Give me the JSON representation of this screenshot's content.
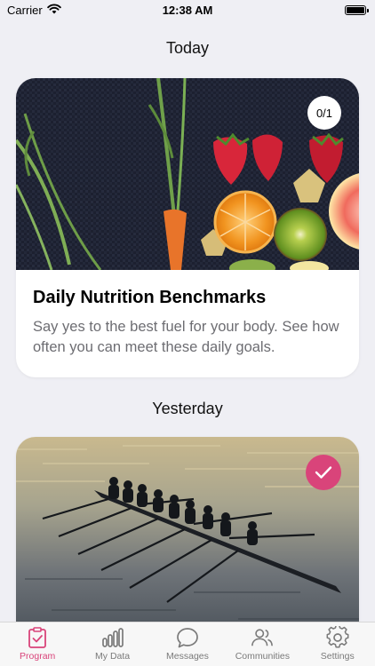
{
  "status_bar": {
    "carrier": "Carrier",
    "time": "12:38 AM"
  },
  "sections": {
    "today": "Today",
    "yesterday": "Yesterday"
  },
  "cards": [
    {
      "title": "Daily Nutrition Benchmarks",
      "description": "Say yes to the best fuel for your body. See how often you can meet these daily goals.",
      "progress_label": "0/1",
      "image_subject": "fruits-and-vegetables-photo"
    },
    {
      "image_subject": "rowing-crew-photo",
      "completed": true
    }
  ],
  "tabs": [
    {
      "label": "Program",
      "icon": "program-icon",
      "active": true
    },
    {
      "label": "My Data",
      "icon": "bar-chart-icon",
      "active": false
    },
    {
      "label": "Messages",
      "icon": "chat-bubble-icon",
      "active": false
    },
    {
      "label": "Communities",
      "icon": "people-icon",
      "active": false
    },
    {
      "label": "Settings",
      "icon": "gear-icon",
      "active": false
    }
  ],
  "colors": {
    "accent": "#d9447a",
    "background": "#efeff4",
    "card": "#ffffff",
    "muted_text": "#6d6d72"
  }
}
